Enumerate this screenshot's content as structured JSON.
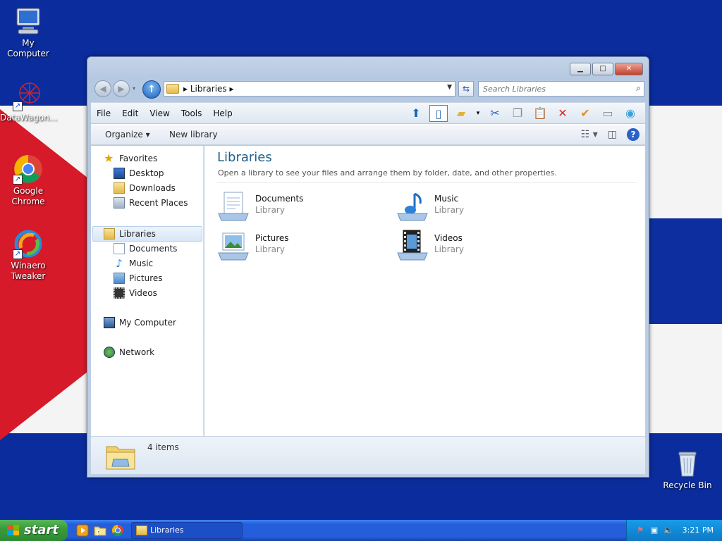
{
  "desktop": {
    "icons": [
      {
        "label": "My Computer"
      },
      {
        "label": "DataWagon..."
      },
      {
        "label": "Google Chrome"
      },
      {
        "label": "Winaero Tweaker"
      },
      {
        "label": "Recycle Bin"
      }
    ]
  },
  "window": {
    "address": {
      "path": "Libraries"
    },
    "search": {
      "placeholder": "Search Libraries"
    },
    "menu": [
      "File",
      "Edit",
      "View",
      "Tools",
      "Help"
    ],
    "commands": {
      "organize": "Organize",
      "new_library": "New library"
    },
    "nav": {
      "favorites": "Favorites",
      "desktop": "Desktop",
      "downloads": "Downloads",
      "recent": "Recent Places",
      "libraries": "Libraries",
      "documents": "Documents",
      "music": "Music",
      "pictures": "Pictures",
      "videos": "Videos",
      "computer": "My Computer",
      "network": "Network"
    },
    "content": {
      "title": "Libraries",
      "subtitle": "Open a library to see your files and arrange them by folder, date, and other properties.",
      "items": [
        {
          "name": "Documents",
          "type": "Library"
        },
        {
          "name": "Music",
          "type": "Library"
        },
        {
          "name": "Pictures",
          "type": "Library"
        },
        {
          "name": "Videos",
          "type": "Library"
        }
      ]
    },
    "details": {
      "count": "4 items"
    }
  },
  "taskbar": {
    "start": "start",
    "task_label": "Libraries",
    "clock": "3:21 PM"
  }
}
